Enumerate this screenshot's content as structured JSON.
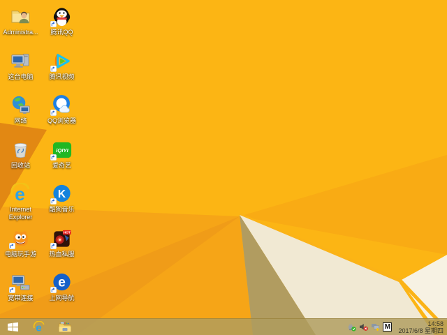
{
  "wallpaper": {
    "base": "#fcb514",
    "facet": "#f9ab14",
    "mid": "#f6a517",
    "fan": "#f09c18",
    "wedge": "#e28813",
    "cream": "#f1e9d3",
    "corner": "#f7f2e3",
    "tan": "#b19c60",
    "ridge": "#fbb317"
  },
  "desktop": {
    "icons": [
      {
        "label": "Administra...",
        "icon": "user-folder-icon",
        "shortcut": false
      },
      {
        "label": "这台电脑",
        "icon": "this-pc-icon",
        "shortcut": false
      },
      {
        "label": "网络",
        "icon": "network-icon",
        "shortcut": false
      },
      {
        "label": "回收站",
        "icon": "recycle-bin-icon",
        "shortcut": false
      },
      {
        "label": "Internet Explorer",
        "icon": "internet-explorer-icon",
        "shortcut": false
      },
      {
        "label": "电脑玩手游",
        "icon": "mobile-game-helper-icon",
        "shortcut": true
      },
      {
        "label": "宽带连接",
        "icon": "broadband-connection-icon",
        "shortcut": true
      },
      {
        "label": "腾讯QQ",
        "icon": "qq-penguin-icon",
        "shortcut": true
      },
      {
        "label": "腾讯视频",
        "icon": "tencent-video-icon",
        "shortcut": true
      },
      {
        "label": "QQ浏览器",
        "icon": "qq-browser-icon",
        "shortcut": true
      },
      {
        "label": "爱奇艺",
        "icon": "iqiyi-icon",
        "shortcut": true
      },
      {
        "label": "酷狗音乐",
        "icon": "kugou-music-icon",
        "shortcut": true
      },
      {
        "label": "热血私服",
        "icon": "hot-game-icon",
        "shortcut": true
      },
      {
        "label": "上网导航",
        "icon": "web-navigation-icon",
        "shortcut": true
      }
    ]
  },
  "glyphs": {
    "ie": "e",
    "kugou": "K",
    "nav": "e",
    "iqiyi": "iQIYI",
    "hot": "HOT"
  },
  "taskbar": {
    "buttons": [
      "start",
      "internet-explorer",
      "file-explorer"
    ],
    "tray_icons": [
      "usb-safely-remove",
      "volume-muted",
      "network-warning",
      "input-method"
    ],
    "ime": "M",
    "clock": {
      "time": "14:58",
      "date": "2017/6/8 星期四"
    }
  }
}
